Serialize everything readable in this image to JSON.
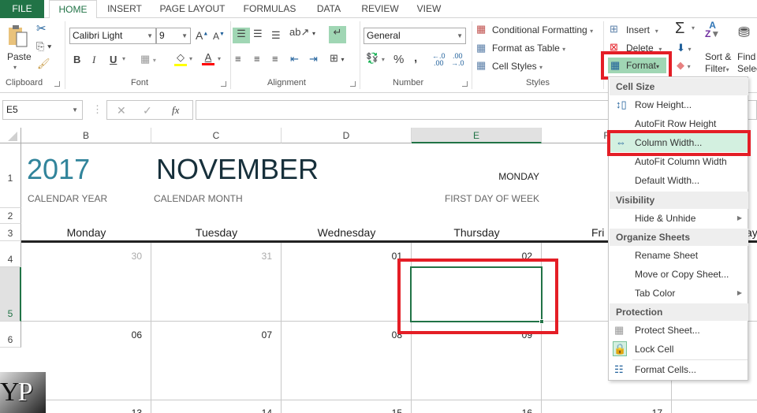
{
  "tabs": [
    "FILE",
    "HOME",
    "INSERT",
    "PAGE LAYOUT",
    "FORMULAS",
    "DATA",
    "REVIEW",
    "VIEW"
  ],
  "active_tab": "HOME",
  "ribbon": {
    "clipboard": {
      "label": "Clipboard",
      "paste": "Paste"
    },
    "font": {
      "label": "Font",
      "font_name": "Calibri Light",
      "font_size": "9",
      "bold": "B",
      "italic": "I",
      "underline": "U"
    },
    "alignment": {
      "label": "Alignment"
    },
    "number": {
      "label": "Number",
      "format": "General",
      "percent": "%",
      "comma": ","
    },
    "styles": {
      "label": "Styles",
      "conditional": "Conditional Formatting",
      "format_table": "Format as Table",
      "cell_styles": "Cell Styles"
    },
    "cells": {
      "insert": "Insert",
      "delete": "Delete",
      "format": "Format"
    },
    "editing": {
      "sort_line1": "Sort &",
      "sort_line2": "Filter",
      "find_line1": "Find",
      "find_line2": "Selec"
    }
  },
  "formula_bar": {
    "name_box": "E5",
    "cancel": "✕",
    "enter": "✓",
    "fx": "fx",
    "value": ""
  },
  "columns": [
    "B",
    "C",
    "D",
    "E",
    "F"
  ],
  "selected_column": "E",
  "rows": [
    "1",
    "2",
    "3",
    "4",
    "5",
    "6"
  ],
  "selected_row": "5",
  "sheet": {
    "year": "2017",
    "year_label": "CALENDAR YEAR",
    "month": "NOVEMBER",
    "month_label": "CALENDAR MONTH",
    "first_day": "MONDAY",
    "first_day_label": "FIRST DAY OF WEEK",
    "day_headers": [
      "Monday",
      "Tuesday",
      "Wednesday",
      "Thursday",
      "Fri",
      "ay"
    ],
    "week1": [
      "30",
      "31",
      "01",
      "02"
    ],
    "week2": [
      "06",
      "07",
      "08",
      "09"
    ],
    "week3": [
      "13",
      "14",
      "15",
      "16",
      "17"
    ]
  },
  "format_menu": {
    "sections": [
      {
        "title": "Cell Size",
        "items": [
          "Row Height...",
          "AutoFit Row Height",
          "Column Width...",
          "AutoFit Column Width",
          "Default Width..."
        ]
      },
      {
        "title": "Visibility",
        "items": [
          "Hide & Unhide"
        ]
      },
      {
        "title": "Organize Sheets",
        "items": [
          "Rename Sheet",
          "Move or Copy Sheet...",
          "Tab Color"
        ]
      },
      {
        "title": "Protection",
        "items": [
          "Protect Sheet...",
          "Lock Cell",
          "Format Cells..."
        ]
      }
    ],
    "highlighted": "Column Width..."
  },
  "watermark": "YP",
  "colors": {
    "accent": "#217346",
    "highlight": "#e41e26",
    "year": "#31849b",
    "menu_hover": "#d3f0e0"
  }
}
